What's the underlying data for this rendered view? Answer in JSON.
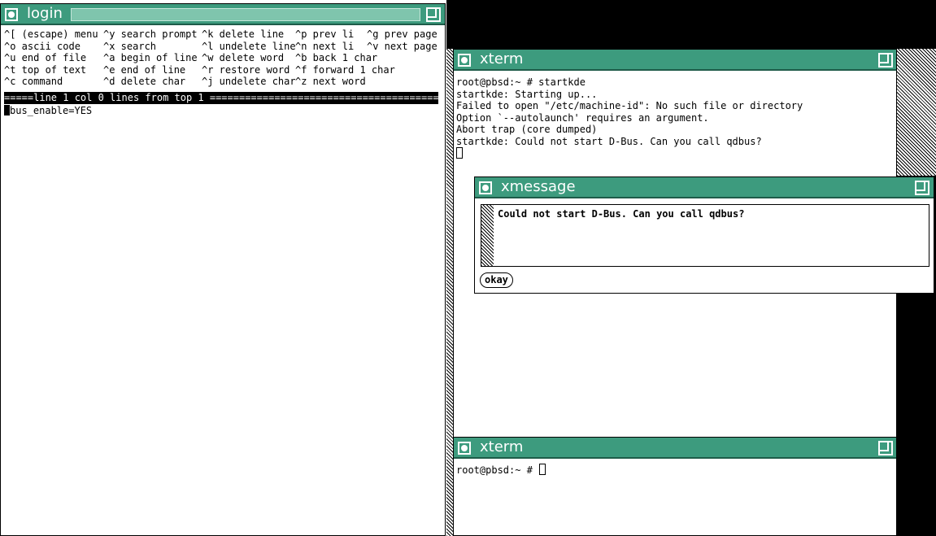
{
  "desktop": {
    "root_color": "#000000",
    "title_color": "#3d9b7e"
  },
  "login": {
    "title": "login",
    "help_rows": [
      [
        "^[ (escape) menu",
        "^y search prompt",
        "^k delete line",
        "^p prev li",
        "^g prev page"
      ],
      [
        "^o ascii code",
        "^x search",
        "^l undelete line",
        "^n next li",
        "^v next page"
      ],
      [
        "^u end of file",
        "^a begin of line",
        "^w delete word",
        "^b back 1 char",
        ""
      ],
      [
        "^t top of text",
        "^e end of line",
        "^r restore word",
        "^f forward 1 char",
        ""
      ],
      [
        "^c command",
        "^d delete char",
        "^j undelete char",
        "^z next word",
        ""
      ]
    ],
    "status_line": "=====line 1 col 0 lines from top 1 ============================================",
    "content_line": "dbus_enable=YES",
    "content_first_char": "d",
    "content_rest": "bus_enable=YES"
  },
  "xterm1": {
    "title": "xterm",
    "lines": [
      "root@pbsd:~ # startkde",
      "startkde: Starting up...",
      "Failed to open \"/etc/machine-id\": No such file or directory",
      "Option `--autolaunch' requires an argument.",
      "Abort trap (core dumped)",
      "startkde: Could not start D-Bus. Can you call qdbus?"
    ]
  },
  "xmessage": {
    "title": "xmessage",
    "message": "Could not start D-Bus. Can you call qdbus?",
    "button_label": "okay"
  },
  "xterm2": {
    "title": "xterm",
    "prompt": "root@pbsd:~ # "
  }
}
